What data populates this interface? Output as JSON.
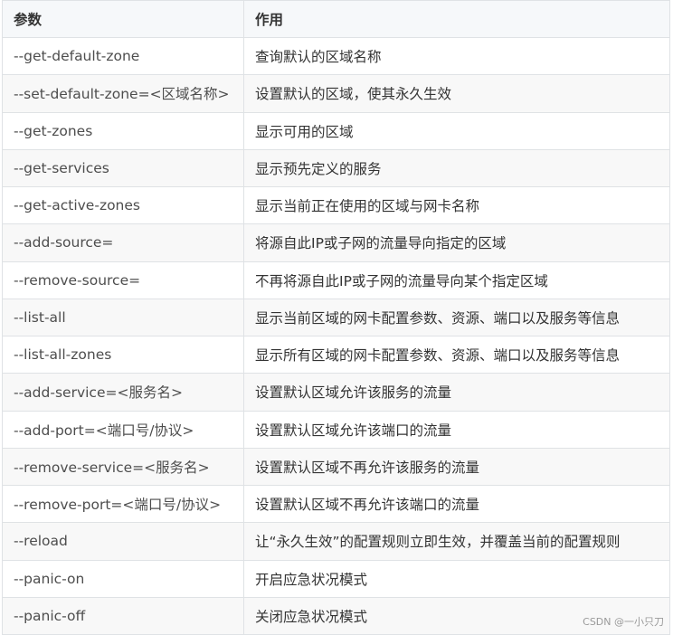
{
  "table": {
    "headers": [
      "参数",
      "作用"
    ],
    "rows": [
      {
        "param": "--get-default-zone",
        "desc": "查询默认的区域名称"
      },
      {
        "param": "--set-default-zone=<区域名称>",
        "desc": "设置默认的区域，使其永久生效"
      },
      {
        "param": "--get-zones",
        "desc": "显示可用的区域"
      },
      {
        "param": "--get-services",
        "desc": "显示预先定义的服务"
      },
      {
        "param": "--get-active-zones",
        "desc": "显示当前正在使用的区域与网卡名称"
      },
      {
        "param": "--add-source=",
        "desc": "将源自此IP或子网的流量导向指定的区域"
      },
      {
        "param": "--remove-source=",
        "desc": "不再将源自此IP或子网的流量导向某个指定区域"
      },
      {
        "param": "--list-all",
        "desc": "显示当前区域的网卡配置参数、资源、端口以及服务等信息"
      },
      {
        "param": "--list-all-zones",
        "desc": "显示所有区域的网卡配置参数、资源、端口以及服务等信息"
      },
      {
        "param": "--add-service=<服务名>",
        "desc": "设置默认区域允许该服务的流量"
      },
      {
        "param": "--add-port=<端口号/协议>",
        "desc": "设置默认区域允许该端口的流量"
      },
      {
        "param": "--remove-service=<服务名>",
        "desc": "设置默认区域不再允许该服务的流量"
      },
      {
        "param": "--remove-port=<端口号/协议>",
        "desc": "设置默认区域不再允许该端口的流量"
      },
      {
        "param": "--reload",
        "desc": "让“永久生效”的配置规则立即生效，并覆盖当前的配置规则"
      },
      {
        "param": "--panic-on",
        "desc": "开启应急状况模式"
      },
      {
        "param": "--panic-off",
        "desc": "关闭应急状况模式"
      }
    ]
  },
  "watermark": "CSDN @一小只刀"
}
